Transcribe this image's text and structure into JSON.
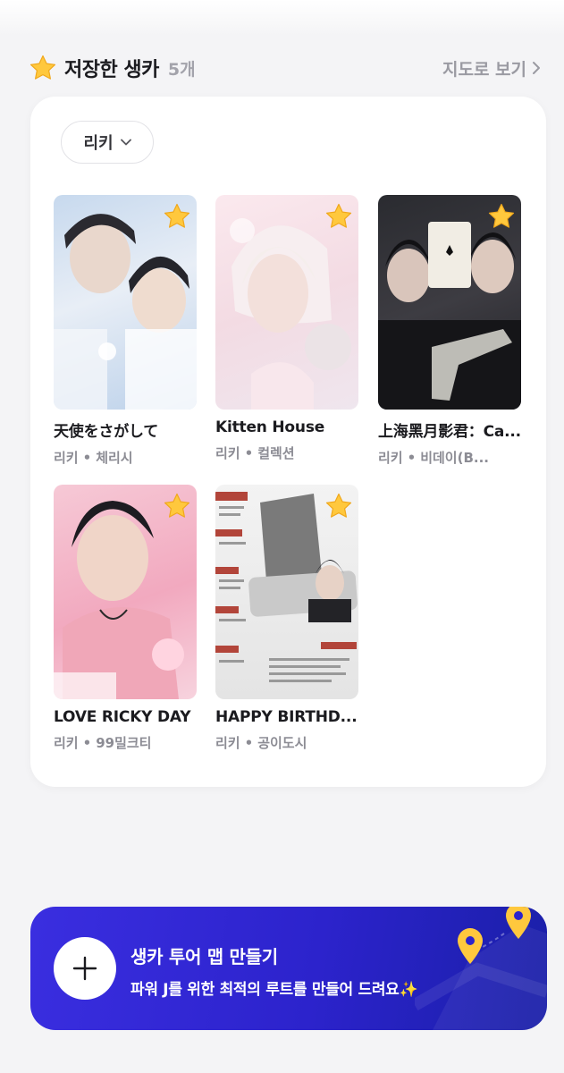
{
  "section": {
    "title": "저장한 생카",
    "count": "5개",
    "map_link": "지도로 보기",
    "title_icon": "star-icon"
  },
  "filter": {
    "label": "리키"
  },
  "items": [
    {
      "title": "天使をさがして",
      "artist": "리키",
      "separator": "•",
      "place": "체리시",
      "favorited": true
    },
    {
      "title": "Kitten House",
      "artist": "리키",
      "separator": "•",
      "place": "컬렉션",
      "favorited": true
    },
    {
      "title": "上海黑月影君：Ca...",
      "artist": "리키",
      "separator": "•",
      "place": "비데이(B...",
      "favorited": true
    },
    {
      "title": "LOVE RICKY DAY",
      "artist": "리키",
      "separator": "•",
      "place": "99밀크티",
      "favorited": true
    },
    {
      "title": "HAPPY BIRTHD...",
      "artist": "리키",
      "separator": "•",
      "place": "공이도시",
      "favorited": true
    }
  ],
  "cta": {
    "title": "생카 투어 맵 만들기",
    "description": "파워 J를 위한 최적의 루트를 만들어 드려요✨",
    "accent": "#3a2ee0"
  },
  "colors": {
    "background": "#f4f4f6",
    "card": "#ffffff",
    "star": "#ffc83d",
    "muted_text": "#8c8c94"
  }
}
